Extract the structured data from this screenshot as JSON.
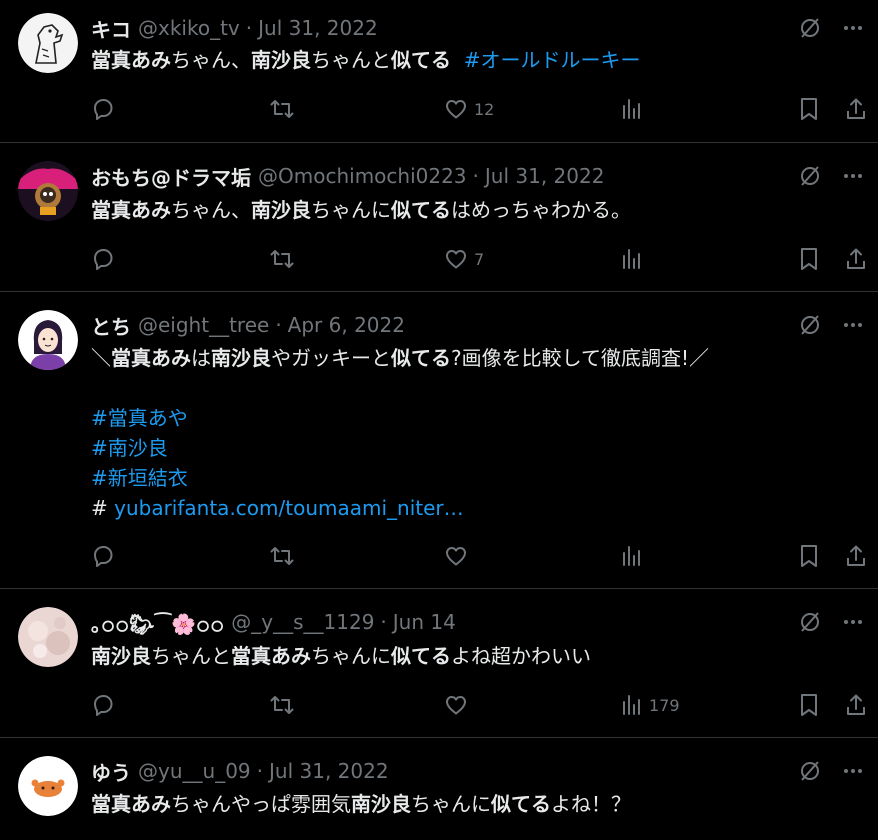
{
  "tweets": [
    {
      "name": "キコ",
      "handle": "@xkiko_tv",
      "date": "Jul 31, 2022",
      "lines": [
        [
          {
            "t": "當真あみ",
            "b": true
          },
          {
            "t": "ちゃん、"
          },
          {
            "t": "南沙良",
            "b": true
          },
          {
            "t": "ちゃんと"
          },
          {
            "t": "似てる",
            "b": true
          },
          {
            "t": "  "
          },
          {
            "t": "#オールドルーキー",
            "link": true
          }
        ]
      ],
      "stats": {
        "replies": "",
        "retweets": "",
        "likes": "12",
        "views": ""
      }
    },
    {
      "name": "おもち@ドラマ垢",
      "handle": "@Omochimochi0223",
      "date": "Jul 31, 2022",
      "lines": [
        [
          {
            "t": "當真あみ",
            "b": true
          },
          {
            "t": "ちゃん、"
          },
          {
            "t": "南沙良",
            "b": true
          },
          {
            "t": "ちゃんに"
          },
          {
            "t": "似てる",
            "b": true
          },
          {
            "t": "はめっちゃわかる。"
          }
        ]
      ],
      "stats": {
        "replies": "",
        "retweets": "",
        "likes": "7",
        "views": ""
      }
    },
    {
      "name": "とち",
      "handle": "@eight__tree",
      "date": "Apr 6, 2022",
      "lines": [
        [
          {
            "t": "＼"
          },
          {
            "t": "當真あみ",
            "b": true
          },
          {
            "t": "は"
          },
          {
            "t": "南沙良",
            "b": true
          },
          {
            "t": "やガッキーと"
          },
          {
            "t": "似てる",
            "b": true
          },
          {
            "t": "?画像を比較して徹底調査!／"
          }
        ],
        [],
        [
          {
            "t": "#當真あや",
            "link": true
          }
        ],
        [
          {
            "t": "#南沙良",
            "link": true
          }
        ],
        [
          {
            "t": "#新垣結衣",
            "link": true
          }
        ],
        [
          {
            "t": "# "
          },
          {
            "t": "yubarifanta.com/toumaami_niter…",
            "link": true
          }
        ]
      ],
      "stats": {
        "replies": "",
        "retweets": "",
        "likes": "",
        "views": ""
      }
    },
    {
      "name": "｡𝚘𝚘🐎︎⁀🌸𝚘𝚘",
      "handle": "@_y__s__1129",
      "date": "Jun 14",
      "lines": [
        [
          {
            "t": "南沙良",
            "b": true
          },
          {
            "t": "ちゃんと"
          },
          {
            "t": "當真あみ",
            "b": true
          },
          {
            "t": "ちゃんに"
          },
          {
            "t": "似てる",
            "b": true
          },
          {
            "t": "よね超かわいい"
          }
        ]
      ],
      "stats": {
        "replies": "",
        "retweets": "",
        "likes": "",
        "views": "179"
      }
    },
    {
      "name": "ゆう",
      "handle": "@yu__u_09",
      "date": "Jul 31, 2022",
      "lines": [
        [
          {
            "t": "當真あみ",
            "b": true
          },
          {
            "t": "ちゃんやっぱ雰囲気"
          },
          {
            "t": "南沙良",
            "b": true
          },
          {
            "t": "ちゃんに"
          },
          {
            "t": "似てる",
            "b": true
          },
          {
            "t": "よね！？"
          }
        ]
      ],
      "stats": {
        "replies": "",
        "retweets": "",
        "likes": "",
        "views": ""
      }
    }
  ],
  "icons": {
    "grok": "grok-icon",
    "more": "more-icon",
    "reply": "reply-icon",
    "retweet": "retweet-icon",
    "like": "like-icon",
    "views": "views-icon",
    "bookmark": "bookmark-icon",
    "share": "share-icon"
  },
  "colors": {
    "background": "#000000",
    "text": "#e7e9ea",
    "muted": "#71767b",
    "link": "#1d9bf0",
    "divider": "#2f3336"
  }
}
